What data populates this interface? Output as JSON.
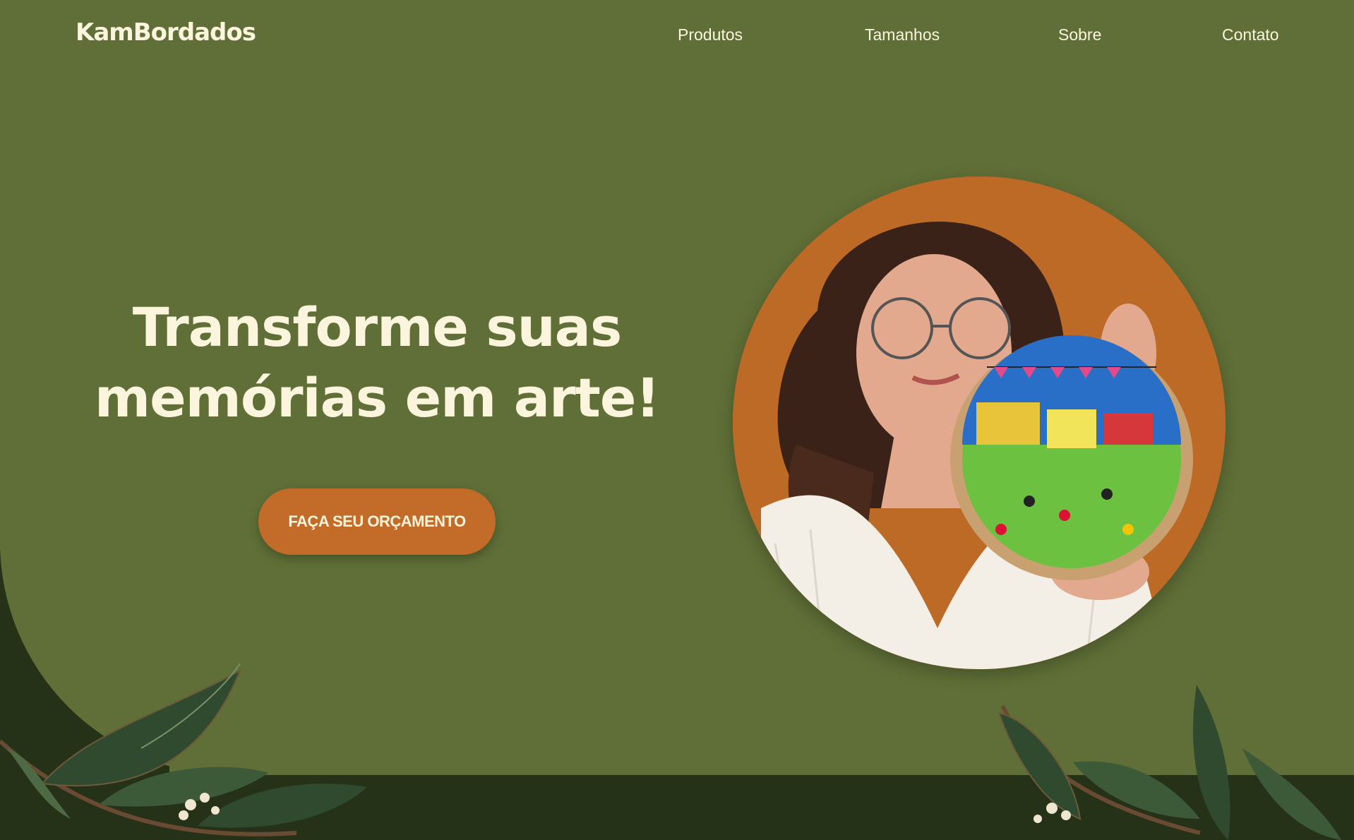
{
  "header": {
    "logo": "KamBordados",
    "nav": [
      {
        "label": "Produtos"
      },
      {
        "label": "Tamanhos"
      },
      {
        "label": "Sobre"
      },
      {
        "label": "Contato"
      }
    ]
  },
  "hero": {
    "title_line1": "Transforme suas",
    "title_line2": "memórias em arte!",
    "cta_label": "FAÇA SEU ORÇAMENTO"
  },
  "colors": {
    "background": "#606f37",
    "dark_green": "#253218",
    "accent": "#c36b28",
    "text_cream": "#fbf5dd"
  },
  "icons": {
    "decorative_left": "olive-branch-icon",
    "decorative_right": "olive-branch-icon"
  }
}
